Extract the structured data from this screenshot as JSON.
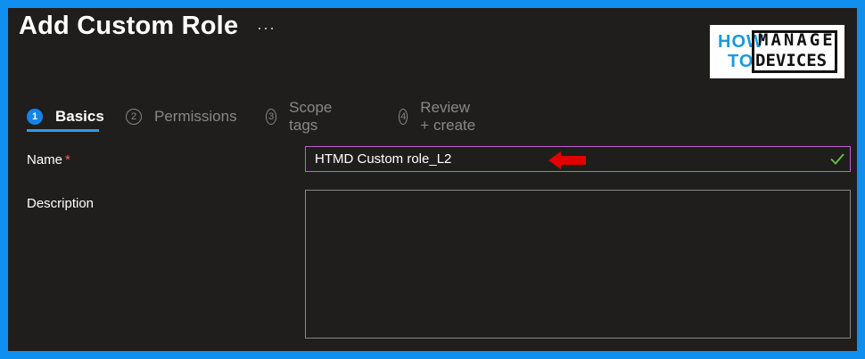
{
  "header": {
    "title": "Add Custom Role",
    "more_label": "···"
  },
  "logo": {
    "line1": "HOW",
    "line2": "TO",
    "line3": "MANAGE",
    "line4": "DEVICES"
  },
  "tabs": [
    {
      "number": "1",
      "label": "Basics",
      "active": true
    },
    {
      "number": "2",
      "label": "Permissions",
      "active": false
    },
    {
      "number": "3",
      "label": "Scope tags",
      "active": false
    },
    {
      "number": "4",
      "label": "Review + create",
      "active": false
    }
  ],
  "form": {
    "name_label": "Name",
    "name_required_mark": "*",
    "name_value": "HTMD Custom role_L2",
    "description_label": "Description",
    "description_value": ""
  },
  "colors": {
    "accent": "#1683e6",
    "focus_border": "#c75ad8",
    "valid_check": "#6cc04a",
    "annotation_arrow": "#e00000",
    "frame_border": "#0f8ff0"
  }
}
